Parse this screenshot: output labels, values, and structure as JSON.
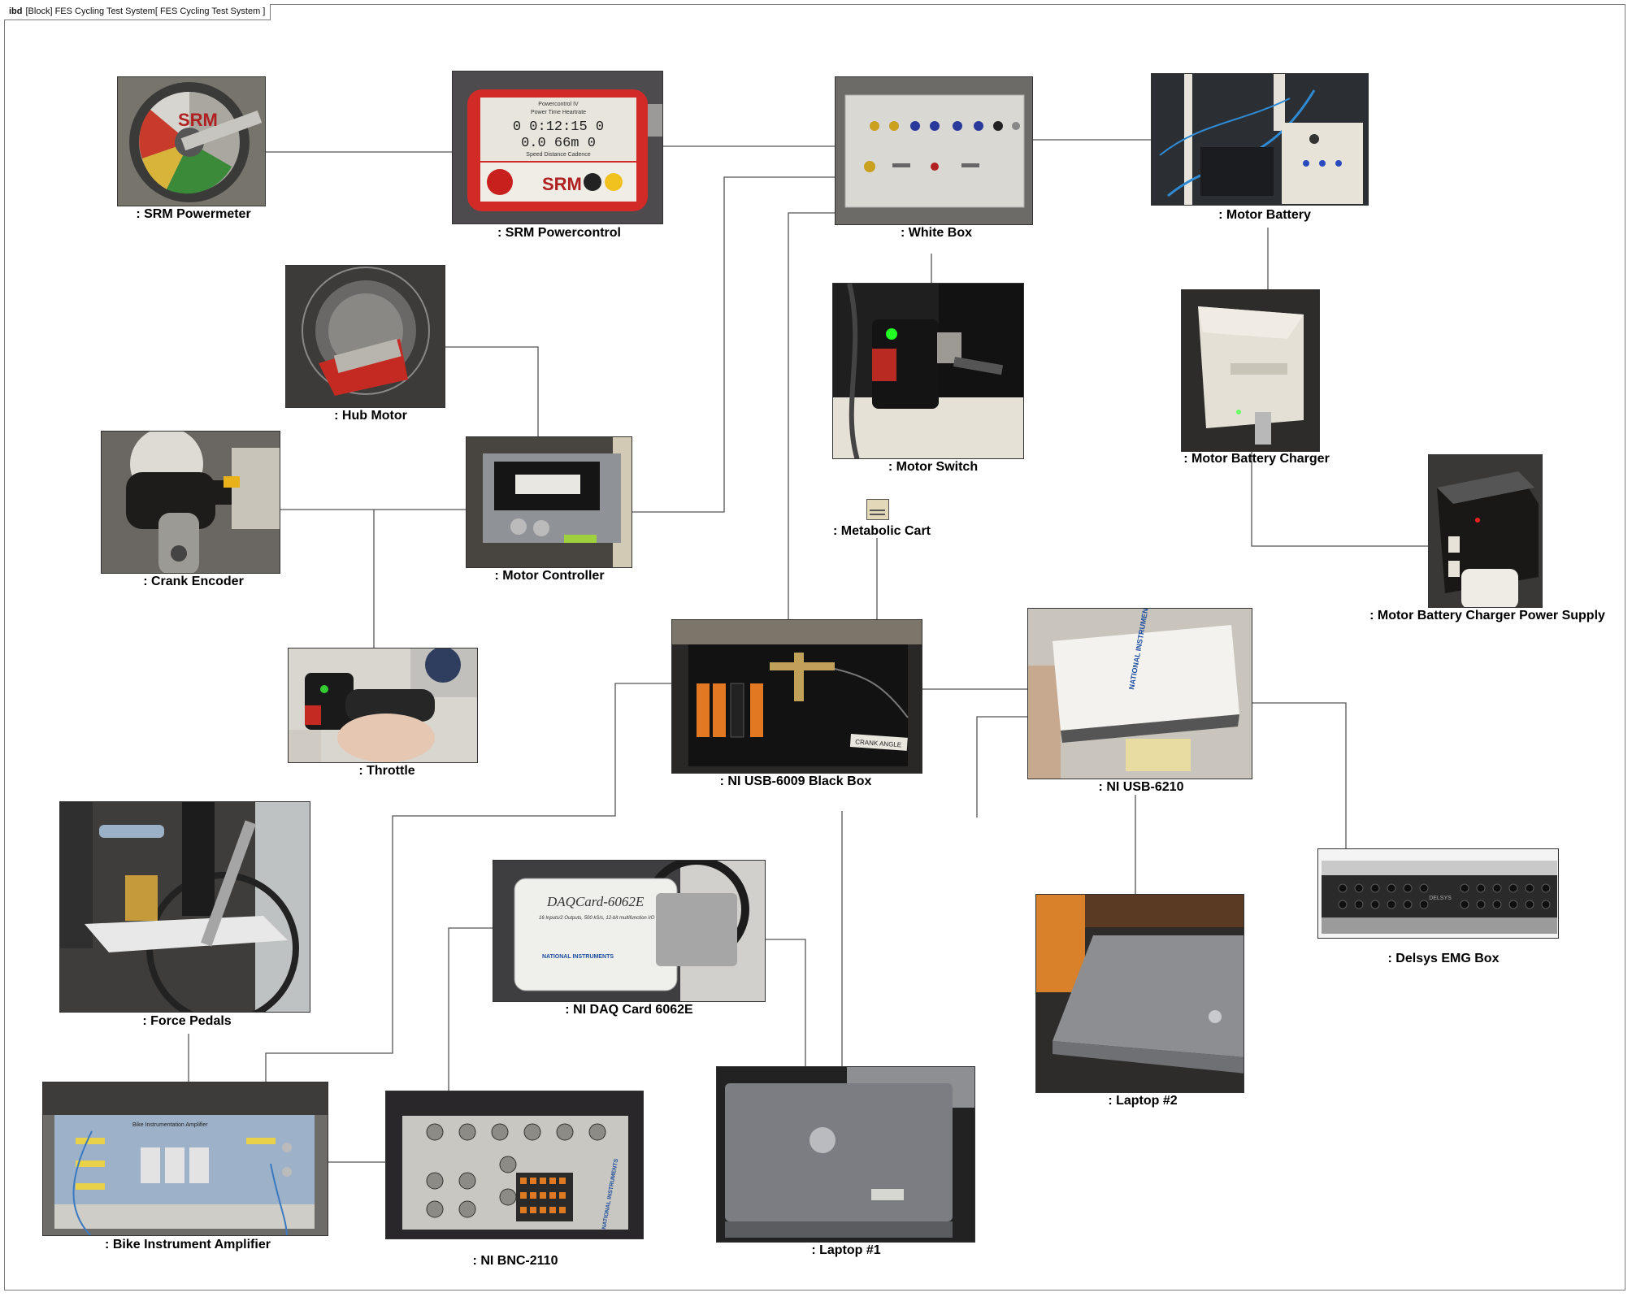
{
  "frame": {
    "kind": "ibd",
    "title": "[Block] FES Cycling Test System[ FES Cycling Test System ]"
  },
  "parts": {
    "srm_powermeter": ": SRM Powermeter",
    "srm_powercontrol": ": SRM Powercontrol",
    "white_box": ": White Box",
    "motor_battery": ": Motor Battery",
    "hub_motor": ": Hub Motor",
    "motor_switch": ": Motor Switch",
    "motor_battery_charger": ": Motor Battery Charger",
    "crank_encoder": ": Crank Encoder",
    "motor_controller": ": Motor Controller",
    "metabolic_cart": ": Metabolic Cart",
    "motor_battery_charger_power_supply": ": Motor Battery Charger Power Supply",
    "throttle": ": Throttle",
    "ni_usb_6009_black_box": ": NI USB-6009 Black Box",
    "ni_usb_6210": ": NI USB-6210",
    "force_pedals": ": Force Pedals",
    "ni_daq_card_6062e": ": NI DAQ Card 6062E",
    "delsys_emg_box": ": Delsys EMG Box",
    "laptop_2": ": Laptop #2",
    "bike_instrument_amplifier": ": Bike Instrument Amplifier",
    "ni_bnc_2110": ": NI BNC-2110",
    "laptop_1": ": Laptop #1"
  },
  "photo_text": {
    "srm_logo": "SRM",
    "powercontrol_header": "Powercontrol IV",
    "powercontrol_cols": "Power   Time   Heartrate",
    "powercontrol_row1": "0  0:12:15  0",
    "powercontrol_row2": "0.0   66m   0",
    "powercontrol_cols2": "Speed  Distance  Cadence",
    "daq_card_title": "DAQCard-6062E",
    "daq_card_sub": "16 Inputs/2 Outputs, 500 kS/s, 12-bit multifunction I/O",
    "ni_brand": "NATIONAL INSTRUMENTS",
    "bnc_brand": "NATIONAL INSTRUMENTS",
    "delsys_brand": "DELSYS",
    "crank_angle": "CRANK ANGLE",
    "amp_title": "Bike Instrumentation Amplifier"
  },
  "colors": {
    "line": "#555555",
    "frame": "#7a7a7a"
  }
}
